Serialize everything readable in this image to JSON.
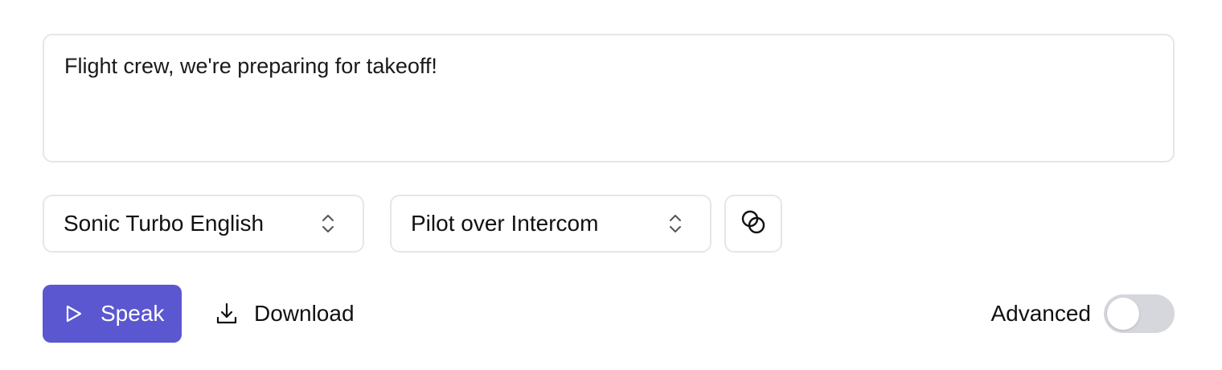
{
  "input": {
    "text": "Flight crew, we're preparing for takeoff!"
  },
  "model_select": {
    "value": "Sonic Turbo English",
    "icon": "chevron-up-down-icon"
  },
  "voice_select": {
    "value": "Pilot over Intercom",
    "icon": "chevron-up-down-icon"
  },
  "mix_button": {
    "icon": "overlapping-circles-icon"
  },
  "actions": {
    "speak_label": "Speak",
    "speak_icon": "play-icon",
    "download_label": "Download",
    "download_icon": "download-icon"
  },
  "advanced": {
    "label": "Advanced",
    "enabled": false
  },
  "colors": {
    "accent": "#5b57d1",
    "border": "#e6e6e6",
    "toggle_off": "#d5d7dd"
  }
}
